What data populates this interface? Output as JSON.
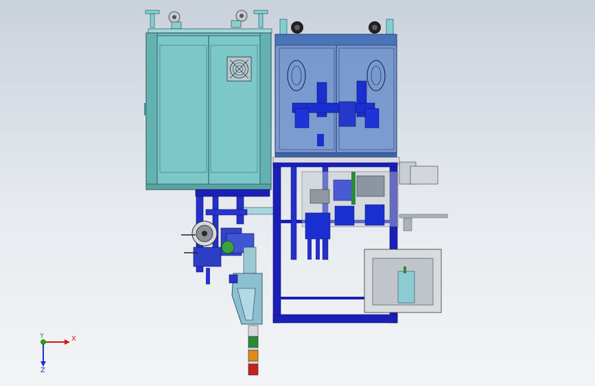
{
  "triad": {
    "x_label": "X",
    "y_label": "Y",
    "z_label": "Z"
  },
  "colors": {
    "background_top": "#c9d1db",
    "background_bottom": "#f3f4f6",
    "cabinet_teal": "#6fbfc0",
    "frame_blue": "#1a1fb8",
    "glass_blue": "#5b84c8",
    "light_gray": "#d9dde1",
    "axis_x": "#d01818",
    "axis_y": "#22a022",
    "axis_z": "#1a2fd0",
    "tower_green": "#2a8a3a",
    "tower_amber": "#e08a1a",
    "tower_red": "#c81f1f"
  }
}
